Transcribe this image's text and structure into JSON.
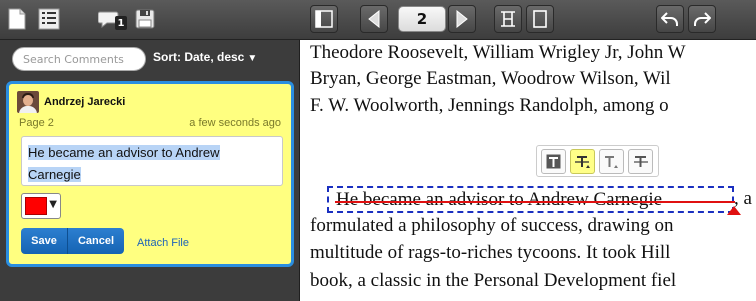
{
  "sidebar": {
    "badge_count": "1",
    "search": {
      "placeholder": "Search Comments",
      "value": ""
    },
    "sort_label": "Sort: Date, desc"
  },
  "comment": {
    "author": "Andrzej Jarecki",
    "page": "Page 2",
    "time": "a few seconds ago",
    "text_line1": "He became an advisor to Andrew",
    "text_line2": "Carnegie",
    "color": "#ff0000",
    "save_label": "Save",
    "cancel_label": "Cancel",
    "attach_label": "Attach File"
  },
  "viewer": {
    "page_number": "2"
  },
  "document": {
    "lines": [
      "Theodore Roosevelt, William Wrigley Jr, John W",
      "Bryan, George Eastman, Woodrow Wilson, Wil",
      "F. W. Woolworth, Jennings Randolph, among o",
      "He became an advisor to Andrew Carnegie, a",
      "formulated a philosophy of success, drawing on",
      "multitude of rags-to-riches tycoons. It took Hill",
      "book, a classic in the Personal Development fiel"
    ],
    "annotation_text": "He became an advisor to Andrew Carnegie",
    "annotation_trailing": ", a"
  },
  "colors": {
    "accent": "#2a8ee0",
    "comment_bg": "#ffff80",
    "strike": "#e01010",
    "annotation_border": "#1a2fc0"
  }
}
